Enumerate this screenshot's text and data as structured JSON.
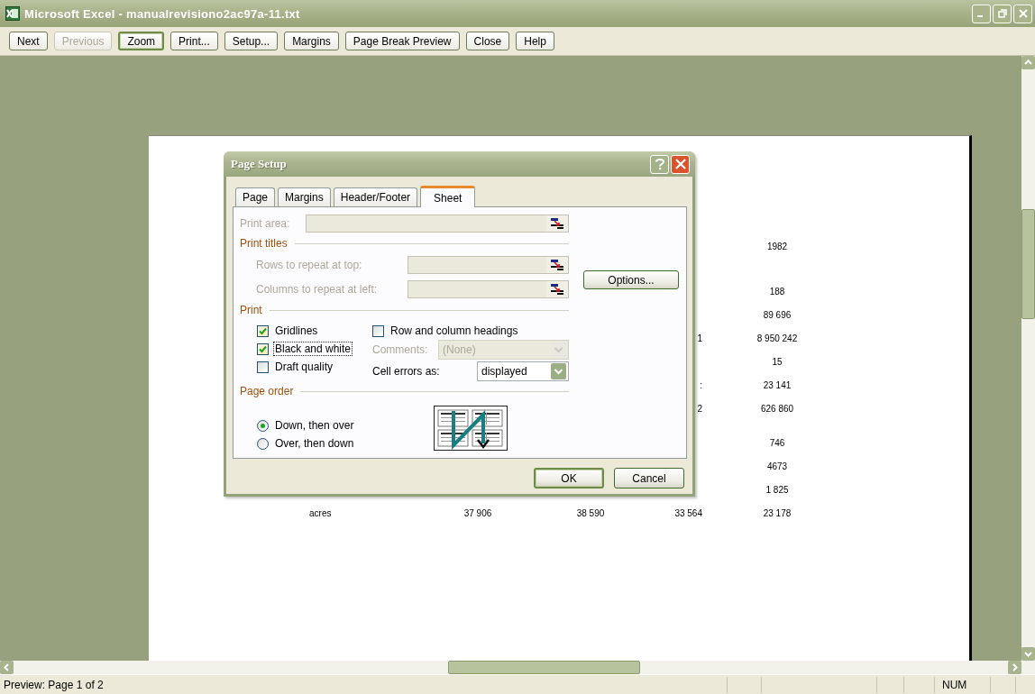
{
  "window": {
    "title": "Microsoft Excel - manualrevisiono2ac97a-11.txt"
  },
  "toolbar": {
    "buttons": [
      {
        "label": "Next",
        "disabled": false,
        "focused": false
      },
      {
        "label": "Previous",
        "disabled": true,
        "focused": false
      },
      {
        "label": "Zoom",
        "disabled": false,
        "focused": true
      },
      {
        "label": "Print...",
        "disabled": false,
        "focused": false
      },
      {
        "label": "Setup...",
        "disabled": false,
        "focused": false
      },
      {
        "label": "Margins",
        "disabled": false,
        "focused": false
      },
      {
        "label": "Page Break Preview",
        "disabled": false,
        "focused": false
      },
      {
        "label": "Close",
        "disabled": false,
        "focused": false
      },
      {
        "label": "Help",
        "disabled": false,
        "focused": false
      }
    ]
  },
  "preview": {
    "rows": [
      {
        "column_5": "1982"
      },
      {
        "column_5": "188"
      },
      {
        "column_5": "89 696"
      },
      {
        "column_4": "1",
        "column_5": "8 950 242"
      },
      {
        "column_5": "15"
      },
      {
        "column_4": ":",
        "column_5": "23 141"
      },
      {
        "column_4": "2",
        "column_5": "626 860"
      },
      {
        "column_5": "746"
      },
      {
        "column_5": "4673"
      },
      {
        "column_5": "1 825"
      },
      {
        "column_1": "acres",
        "column_2": "37 906",
        "column_3": "38 590",
        "column_4": "33 564",
        "column_5": "23 178"
      }
    ]
  },
  "dialog": {
    "title": "Page Setup",
    "tabs": [
      {
        "label": "Page",
        "selected": false
      },
      {
        "label": "Margins",
        "selected": false
      },
      {
        "label": "Header/Footer",
        "selected": false
      },
      {
        "label": "Sheet",
        "selected": true
      }
    ],
    "print_area": {
      "label": "Print area:",
      "disabled": true
    },
    "print_titles": {
      "heading": "Print titles",
      "fields": [
        {
          "label": "Rows to repeat at top:",
          "disabled": true
        },
        {
          "label": "Columns to repeat at left:",
          "disabled": true
        }
      ]
    },
    "options_button": "Options...",
    "print": {
      "heading": "Print",
      "checkboxes": [
        {
          "label": "Gridlines",
          "checked": true,
          "focused": false
        },
        {
          "label": "Black and white",
          "checked": true,
          "focused": true
        },
        {
          "label": "Draft quality",
          "checked": false,
          "focused": false
        }
      ],
      "row_and_column_headings": {
        "label": "Row and column headings",
        "checked": false
      },
      "comments": {
        "label": "Comments:",
        "value": "(None)",
        "disabled": true
      },
      "cell_errors": {
        "label": "Cell errors as:",
        "value": "displayed",
        "disabled": false
      }
    },
    "page_order": {
      "heading": "Page order",
      "options": [
        {
          "label": "Down, then over",
          "selected": true
        },
        {
          "label": "Over, then down",
          "selected": false
        }
      ]
    },
    "buttons": [
      {
        "label": "OK",
        "default": true
      },
      {
        "label": "Cancel",
        "default": false
      }
    ]
  },
  "status_bar": {
    "text": "Preview: Page 1 of 2",
    "indicators": [
      "NUM"
    ]
  }
}
